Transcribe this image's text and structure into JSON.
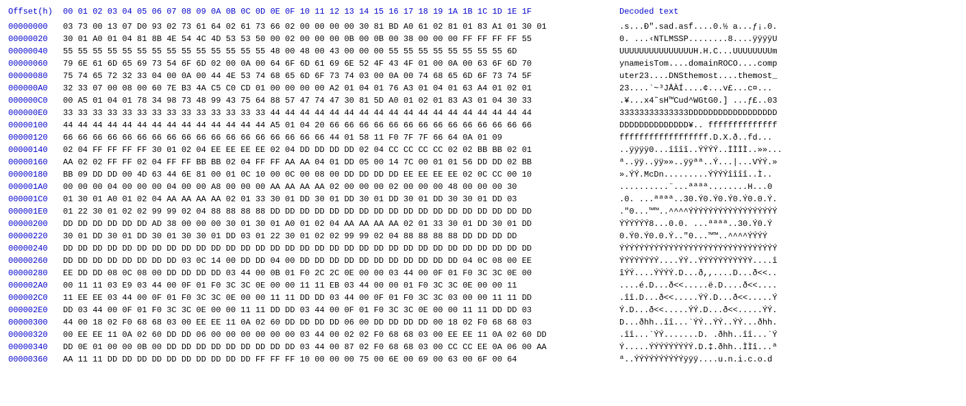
{
  "header": {
    "offset_label": "Offset(h)",
    "hex_columns": "00 01 02 03 04 05 06 07 08 09 0A 0B 0C 0D 0E 0F 10 11 12 13 14 15 16 17 18 19 1A 1B 1C 1D 1E 1F",
    "decoded_label": "Decoded text"
  },
  "rows": [
    {
      "offset": "00000000",
      "hex": "03 73 00 13 07 D0 93 02 73 61 64 02 61 73 66 02 00 00 00 00 30 81 BD A0 61 02 81 01 83 A1 01 30 01",
      "decoded": ".s...Ð\".sad.asf....0.½ a...ƒ¡.0."
    },
    {
      "offset": "00000020",
      "hex": "30 01 A0 01 04 81 8B 4E 54 4C 4D 53 53 50 00 02 00 00 00 0B 00 0B 00 38 00 00 00 FF FF FF FF 55",
      "decoded": "0. ...‹NTLMSSP........8....ÿÿÿÿU"
    },
    {
      "offset": "00000040",
      "hex": "55 55 55 55 55 55 55 55 55 55 55 55 55 55 48 00 48 00 43 00 00 00 55 55 55 55 55 55 55 55 6D",
      "decoded": "UUUUUUUUUUUUUUUH.H.C...UUUUUUUUm"
    },
    {
      "offset": "00000060",
      "hex": "79 6E 61 6D 65 69 73 54 6F 6D 02 00 0A 00 64 6F 6D 61 69 6E 52 4F 43 4F 01 00 0A 00 63 6F 6D 70",
      "decoded": "ynameisTom....domainROCO....comp"
    },
    {
      "offset": "00000080",
      "hex": "75 74 65 72 32 33 04 00 0A 00 44 4E 53 74 68 65 6D 6F 73 74 03 00 0A 00 74 68 65 6D 6F 73 74 5F",
      "decoded": "uter23....DNSthemost....themost_"
    },
    {
      "offset": "000000A0",
      "hex": "32 33 07 00 08 00 60 7E B3 4A C5 C0 CD 01 00 00 00 00 A2 01 04 01 76 A3 01 04 01 63 A4 01 02 01",
      "decoded": "23....`~³JÅÀÍ....¢...v£...c¤..."
    },
    {
      "offset": "000000C0",
      "hex": "00 A5 01 04 01 78 34 98 73 48 99 43 75 64 88 57 47 74 47 30 81 5D A0 01 02 01 83 A3 01 04 30 33",
      "decoded": ".¥...x4˜sH™Cud^WGtG0.] ...ƒ£..03"
    },
    {
      "offset": "000000E0",
      "hex": "33 33 33 33 33 33 33 33 33 33 33 33 33 33 44 44 44 44 44 44 44 44 44 44 44 44 44 44 44 44 44 44",
      "decoded": "33333333333333DDDDDDDDDDDDDDDDDD"
    },
    {
      "offset": "00000100",
      "hex": "44 44 44 44 44 44 44 44 44 44 44 44 44 44 A5 01 04 20 66 66 66 66 66 66 66 66 66 66 66 66 66 66",
      "decoded": "DDDDDDDDDDDDDD¥.. ffffffffffffff"
    },
    {
      "offset": "00000120",
      "hex": "66 66 66 66 66 66 66 66 66 66 66 66 66 66 66 66 66 66 44 01 58 11 F0 7F 7F 66 64 0A 01 09",
      "decoded": "ffffffffffffffffff.D.X.ð..fd..."
    },
    {
      "offset": "00000140",
      "hex": "02 04 FF FF FF FF 30 01 02 04 EE EE EE EE 02 04 DD DD DD DD 02 04 CC CC CC CC 02 02 BB BB 02 01",
      "decoded": "..ÿÿÿÿ0...îîîî..ÝÝÝÝ..ÌÌÌÌ..»»..."
    },
    {
      "offset": "00000160",
      "hex": "AA 02 02 FF FF 02 04 FF FF BB BB 02 04 FF FF AA AA 04 01 DD 05 00 14 7C 00 01 01 56 DD DD 02 BB",
      "decoded": "ª..ÿÿ..ÿÿ»»..ÿÿªª..Ý...|...VÝÝ.»"
    },
    {
      "offset": "00000180",
      "hex": "BB 09 DD DD 00 4D 63 44 6E 81 00 01 0C 10 00 0C 00 08 00 DD DD DD DD EE EE EE EE 02 0C CC 00 10",
      "decoded": "».ÝÝ.McDn.........ÝÝÝÝîîîî..Ì.."
    },
    {
      "offset": "000001A0",
      "hex": "00 00 00 04 00 00 00 04 00 00 A8 00 00 00 AA AA AA AA 02 00 00 00 02 00 00 00 48 00 00 00 30",
      "decoded": "..........¨...ªªªª........H...0"
    },
    {
      "offset": "000001C0",
      "hex": "01 30 01 A0 01 02 04 AA AA AA AA 02 01 33 30 01 DD 30 01 DD 30 01 DD 30 01 DD 30 30 01 DD 03",
      "decoded": ".0. ...ªªªª..30.Ý0.Ý0.Ý0.Ý0.0.Ý."
    },
    {
      "offset": "000001E0",
      "hex": "01 22 30 01 02 02 99 99 02 04 88 88 88 88 DD DD DD DD DD DD DD DD DD DD DD DD DD DD DD DD DD DD",
      "decoded": ".\"0...™™..^^^^ÝÝÝÝÝÝÝÝÝÝÝÝÝÝÝÝÝÝ"
    },
    {
      "offset": "00000200",
      "hex": "DD DD DD DD DD DD AD 38 00 00 00 30 01 30 01 A0 01 02 04 AA AA AA AA 02 01 33 30 01 DD 30 01 DD",
      "decoded": "ÝÝÝÝÝÝ­8...0.0. ...ªªªª..30.Ý0.Ý"
    },
    {
      "offset": "00000220",
      "hex": "30 01 DD 30 01 DD 30 01 30 30 01 DD 03 01 22 30 01 02 02 99 99 02 04 88 88 88 88 DD DD DD DD",
      "decoded": "0.Ý0.Ý0.0.Ý..\"0...™™..^^^^ÝÝÝÝ"
    },
    {
      "offset": "00000240",
      "hex": "DD DD DD DD DD DD DD DD DD DD DD DD DD DD DD DD DD DD DD DD DD DD DD DD DD DD DD DD DD DD DD DD",
      "decoded": "ÝÝÝÝÝÝÝÝÝÝÝÝÝÝÝÝÝÝÝÝÝÝÝÝÝÝÝÝÝÝÝÝ"
    },
    {
      "offset": "00000260",
      "hex": "DD DD DD DD DD DD DD DD 03 0C 14 00 DD DD 04 00 DD DD DD DD DD DD DD DD DD DD DD 04 0C 08 00 EE",
      "decoded": "ÝÝÝÝÝÝÝÝ....ÝÝ..ÝÝÝÝÝÝÝÝÝÝÝ....î"
    },
    {
      "offset": "00000280",
      "hex": "EE DD DD 08 0C 08 00 DD DD DD DD 03 44 00 0B 01 F0 2C 2C 0E 00 00 03 44 00 0F 01 F0 3C 3C 0E 00",
      "decoded": "îÝÝ....ÝÝÝÝ.D...ð,,....D...ð<<.."
    },
    {
      "offset": "000002A0",
      "hex": "00 11 11 03 E9 03 44 00 0F 01 F0 3C 3C 0E 00 00 11 11 EB 03 44 00 00 01 F0 3C 3C 0E 00 00 11",
      "decoded": "....é.D...ð<<.....ë.D....ð<<...."
    },
    {
      "offset": "000002C0",
      "hex": "11 EE EE 03 44 00 0F 01 F0 3C 3C 0E 00 00 11 11 DD DD 03 44 00 0F 01 F0 3C 3C 03 00 00 11 11 DD",
      "decoded": ".îî.D...ð<<.....ÝÝ.D...ð<<.....Ý"
    },
    {
      "offset": "000002E0",
      "hex": "DD 03 44 00 0F 01 F0 3C 3C 0E 00 00 11 11 DD DD 03 44 00 0F 01 F0 3C 3C 0E 00 00 11 11 DD DD 03",
      "decoded": "Ý.D...ð<<.....ÝÝ.D...ð<<.....ÝÝ."
    },
    {
      "offset": "00000300",
      "hex": "44 00 18 02 F0 68 68 03 00 EE EE 11 0A 02 60 DD DD DD DD 06 00 DD DD DD DD 00 18 02 F0 68 68 03",
      "decoded": "D...ðhh..îî...`ÝÝ..ÝÝ..ÝÝ...ðhh."
    },
    {
      "offset": "00000320",
      "hex": "00 EE EE 11 0A 02 60 DD DD 06 00 00 00 00 00 00 03 44 00 02 02 F0 68 68 03 00 EE EE 11 0A 02 60 DD",
      "decoded": ".îî...`ÝÝ.......D. .ðhh..îî...`Ý"
    },
    {
      "offset": "00000340",
      "hex": "DD 0E 01 00 00 0B 00 DD DD DD DD DD DD DD DD DD 03 44 00 87 02 F0 68 68 03 00 CC CC EE 0A 06 00 AA",
      "decoded": "Ý.....ÝÝÝÝÝÝÝÝÝ.D.‡.ðhh..ÌÌî...ª"
    },
    {
      "offset": "00000360",
      "hex": "AA 11 11 DD DD DD DD DD DD DD DD DD DD FF FF FF 10 00 00 00 75 00 6E 00 69 00 63 00 6F 00 64",
      "decoded": "ª..ÝÝÝÝÝÝÝÝÝÝÿÿÿ....u.n.i.c.o.d"
    }
  ]
}
